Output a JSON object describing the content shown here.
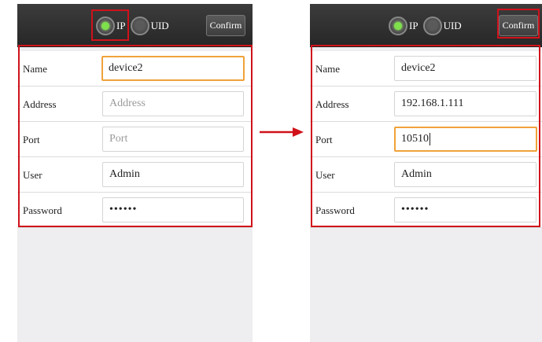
{
  "colors": {
    "highlight": "#d0121b",
    "radio_on": "#7ee04b",
    "focus_border": "#f0a23a"
  },
  "left_screen": {
    "mode_ip_label": "IP",
    "mode_uid_label": "UID",
    "selected_mode": "IP",
    "confirm_label": "Confirm",
    "fields": {
      "name": {
        "label": "Name",
        "value": "device2"
      },
      "address": {
        "label": "Address",
        "value": "",
        "placeholder": "Address"
      },
      "port": {
        "label": "Port",
        "value": "",
        "placeholder": "Port"
      },
      "user": {
        "label": "User",
        "value": "Admin"
      },
      "password": {
        "label": "Password",
        "value": "••••••"
      }
    }
  },
  "right_screen": {
    "mode_ip_label": "IP",
    "mode_uid_label": "UID",
    "selected_mode": "IP",
    "confirm_label": "Confirm",
    "fields": {
      "name": {
        "label": "Name",
        "value": "device2"
      },
      "address": {
        "label": "Address",
        "value": "192.168.1.111"
      },
      "port": {
        "label": "Port",
        "value": "10510"
      },
      "user": {
        "label": "User",
        "value": "Admin"
      },
      "password": {
        "label": "Password",
        "value": "••••••"
      }
    }
  }
}
